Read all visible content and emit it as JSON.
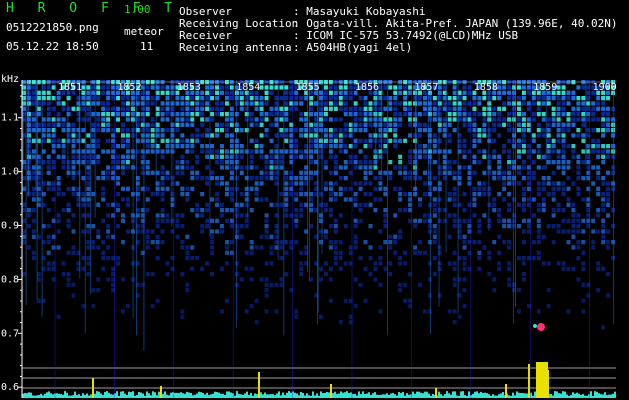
{
  "header": {
    "brand": "H R O F F T",
    "version": "1.00",
    "filename": "0512221850.png",
    "datetime": "05.12.22 18:50",
    "meteor_label": "meteor",
    "meteor_count": "11",
    "info": [
      {
        "label": "Observer",
        "value": ": Masayuki Kobayashi"
      },
      {
        "label": "Receiving Location",
        "value": ": Ogata-vill. Akita-Pref. JAPAN (139.96E, 40.02N)"
      },
      {
        "label": "Receiver",
        "value": ": ICOM IC-575 53.7492(@LCD)MHz USB"
      },
      {
        "label": "Receiving antenna",
        "value": ": A504HB(yagi 4el)"
      }
    ]
  },
  "chart_data": {
    "type": "heatmap",
    "y_unit": "kHz",
    "y_ticks": [
      "1.1",
      "1.0",
      "0.9",
      "0.8",
      "0.7",
      "0.6"
    ],
    "ylim": [
      0.58,
      1.17
    ],
    "time_labels": [
      "1851",
      "1852",
      "1853",
      "1854",
      "1855",
      "1856",
      "1857",
      "1858",
      "1859",
      "1900"
    ],
    "colors": {
      "background": "#000000",
      "noise_low": "#0a2a9a",
      "noise_mid": "#1f6fe0",
      "noise_high": "#38e0d0",
      "label_green": "#22e022",
      "meteor": "#ff3070",
      "trace": "#e8e000"
    }
  }
}
